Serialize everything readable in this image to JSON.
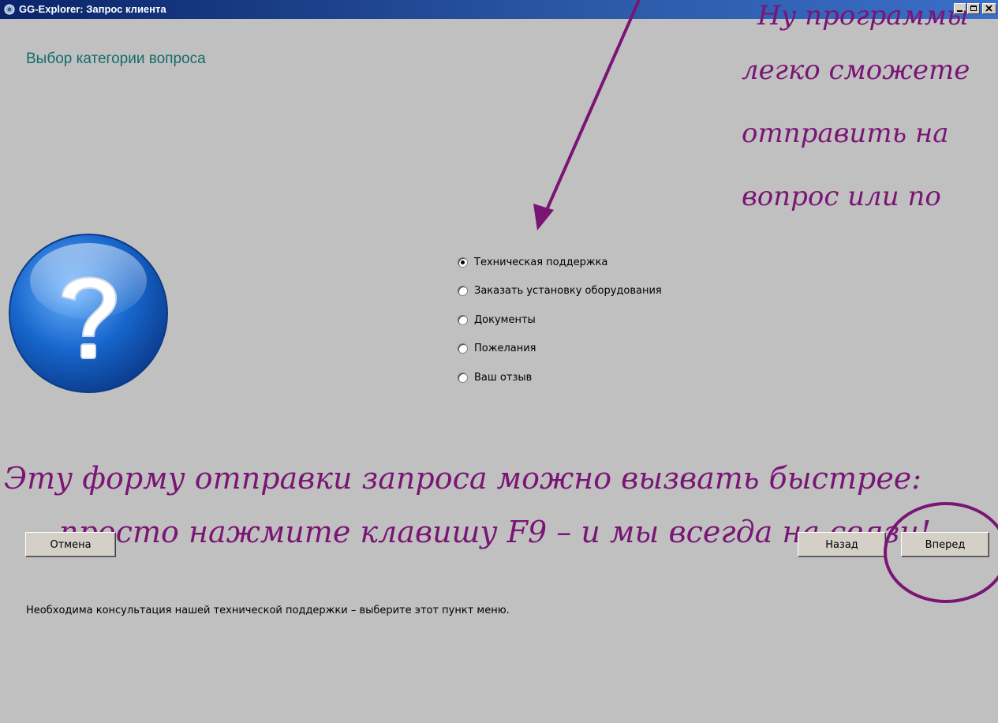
{
  "window": {
    "title": "GG-Explorer: Запрос клиента",
    "minimize_label": "_",
    "maximize_label": "□",
    "close_label": "×"
  },
  "page": {
    "heading": "Выбор категории вопроса",
    "icon": "question-mark-icon"
  },
  "options": [
    {
      "label": "Техническая поддержка",
      "selected": true
    },
    {
      "label": "Заказать установку оборудования",
      "selected": false
    },
    {
      "label": "Документы",
      "selected": false
    },
    {
      "label": "Пожелания",
      "selected": false
    },
    {
      "label": "Ваш отзыв",
      "selected": false
    }
  ],
  "annotations": {
    "side_lines": [
      "Ну программы",
      "легко сможете",
      "отправить на",
      "вопрос или по"
    ],
    "bottom_line1": "Эту форму отправки запроса можно вызвать быстрее:",
    "bottom_line2": "просто нажмите клавишу F9 – и мы всегда на связи!",
    "color": "#7a1575"
  },
  "description": "Необходима консультация нашей технической поддержки – выберите этот пункт меню.",
  "buttons": {
    "cancel": "Отмена",
    "back": "Назад",
    "next": "Вперед"
  },
  "colors": {
    "heading": "#156b6b",
    "titlebar": "#0a246a",
    "background": "#c0c0c0"
  }
}
